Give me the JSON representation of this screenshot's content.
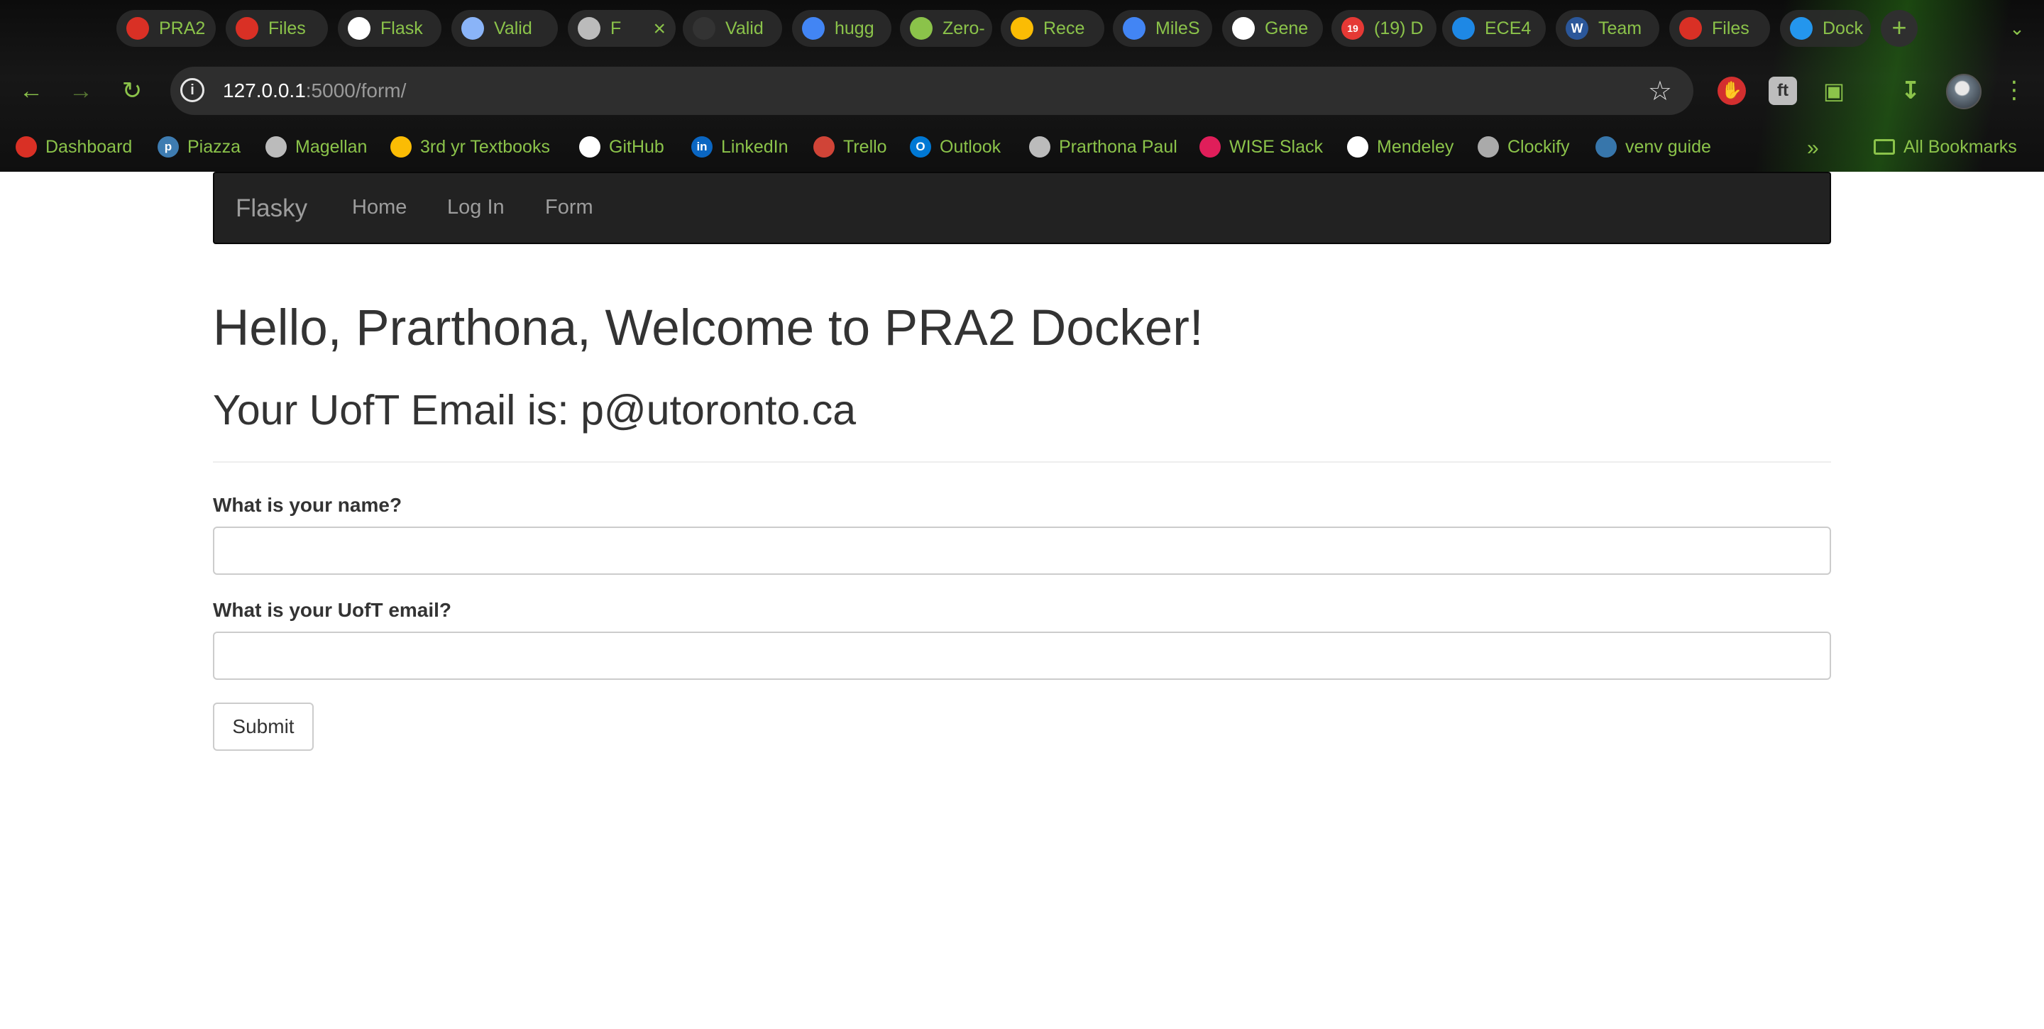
{
  "browser": {
    "tabs": [
      {
        "title": "PRA2",
        "icon": "uoft-crest-icon",
        "color": "#d93025"
      },
      {
        "title": "Files",
        "icon": "uoft-crest-icon",
        "color": "#d93025"
      },
      {
        "title": "Flask",
        "icon": "openai-icon",
        "color": "#ffffff"
      },
      {
        "title": "Valid",
        "icon": "document-icon",
        "color": "#8ab4f8"
      },
      {
        "title": "F",
        "icon": "globe-icon",
        "color": "#bbbbbb"
      },
      {
        "title": "Valid",
        "icon": "dark-favicon-icon",
        "color": "#333333"
      },
      {
        "title": "hugg",
        "icon": "google-icon",
        "color": "#4285f4"
      },
      {
        "title": "Zero-",
        "icon": "eyes-icon",
        "color": "#8bc34a"
      },
      {
        "title": "Rece",
        "icon": "google-drive-icon",
        "color": "#fbbc04"
      },
      {
        "title": "MileS",
        "icon": "google-docs-icon",
        "color": "#4285f4"
      },
      {
        "title": "Gene",
        "icon": "github-icon",
        "color": "#ffffff"
      },
      {
        "title": "(19) D",
        "icon": "notification-badge-icon",
        "color": "#e53935",
        "badge": "19"
      },
      {
        "title": "ECE4",
        "icon": "onedrive-icon",
        "color": "#1e88e5"
      },
      {
        "title": "Team",
        "icon": "word-icon",
        "color": "#2b579a",
        "glyph": "W"
      },
      {
        "title": "Files",
        "icon": "uoft-crest-icon",
        "color": "#d93025"
      },
      {
        "title": "Dock",
        "icon": "docker-icon",
        "color": "#2496ed"
      }
    ],
    "active_tab_index": 4,
    "url_host": "127.0.0.1",
    "url_rest": ":5000/form/",
    "bookmarks": [
      {
        "label": "Dashboard",
        "icon": "uoft-crest-icon",
        "color": "#d93025"
      },
      {
        "label": "Piazza",
        "icon": "piazza-icon",
        "color": "#3e7cb1",
        "glyph": "p"
      },
      {
        "label": "Magellan",
        "icon": "globe-icon",
        "color": "#bbbbbb"
      },
      {
        "label": "3rd yr Textbooks",
        "icon": "google-drive-icon",
        "color": "#fbbc04"
      },
      {
        "label": "GitHub",
        "icon": "github-icon",
        "color": "#ffffff"
      },
      {
        "label": "LinkedIn",
        "icon": "linkedin-icon",
        "color": "#0a66c2",
        "glyph": "in"
      },
      {
        "label": "Trello",
        "icon": "trello-icon",
        "color": "#d04437"
      },
      {
        "label": "Outlook",
        "icon": "outlook-icon",
        "color": "#0078d4",
        "glyph": "O"
      },
      {
        "label": "Prarthona Paul",
        "icon": "globe-icon",
        "color": "#bbbbbb"
      },
      {
        "label": "WISE Slack",
        "icon": "slack-icon",
        "color": "#e01e5a"
      },
      {
        "label": "Mendeley",
        "icon": "mendeley-icon",
        "color": "#ffffff"
      },
      {
        "label": "Clockify",
        "icon": "clockify-icon",
        "color": "#aaaaaa"
      },
      {
        "label": "venv guide",
        "icon": "python-icon",
        "color": "#3776ab"
      }
    ],
    "all_bookmarks_label": "All Bookmarks",
    "accent_color": "#8bc34a"
  },
  "navbar": {
    "brand": "Flasky",
    "links": [
      "Home",
      "Log In",
      "Form"
    ]
  },
  "main": {
    "heading": "Hello, Prarthona, Welcome to PRA2 Docker!",
    "subheading": "Your UofT Email is: p@utoronto.ca"
  },
  "form": {
    "name_label": "What is your name?",
    "name_value": "",
    "email_label": "What is your UofT email?",
    "email_value": "",
    "submit_label": "Submit"
  }
}
